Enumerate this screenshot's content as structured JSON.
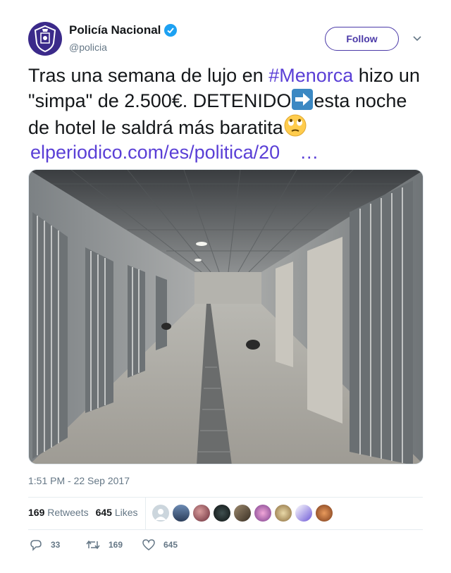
{
  "account": {
    "name": "Policía Nacional",
    "handle": "@policia",
    "avatar_icon": "police-shield-icon",
    "verified_icon": "verified-badge-icon"
  },
  "header": {
    "follow_label": "Follow",
    "menu_icon": "chevron-down-icon"
  },
  "tweet": {
    "part1": "Tras una semana de lujo en ",
    "hashtag": "#Menorca",
    "part2": " hizo un \"simpa\" de 2.500€. DETENIDO",
    "arrow_icon": "right-arrow-emoji-icon",
    "part3": "esta noche de hotel le saldrá más baratita",
    "face_icon": "eye-roll-face-emoji-icon",
    "link": "elperiodico.com/es/politica/20",
    "ellipsis": "…"
  },
  "media": {
    "icon": "jail-corridor-photo"
  },
  "timestamp": "1:51 PM - 22 Sep 2017",
  "stats": {
    "retweets_count": "169",
    "retweets_label": "Retweets",
    "likes_count": "645",
    "likes_label": "Likes"
  },
  "actions": {
    "replies": "33",
    "retweets": "169",
    "likes": "645"
  },
  "colors": {
    "accent": "#4b3aa8",
    "hashtag": "#5a3fd6",
    "muted": "#657786",
    "verified": "#1da1f2"
  }
}
